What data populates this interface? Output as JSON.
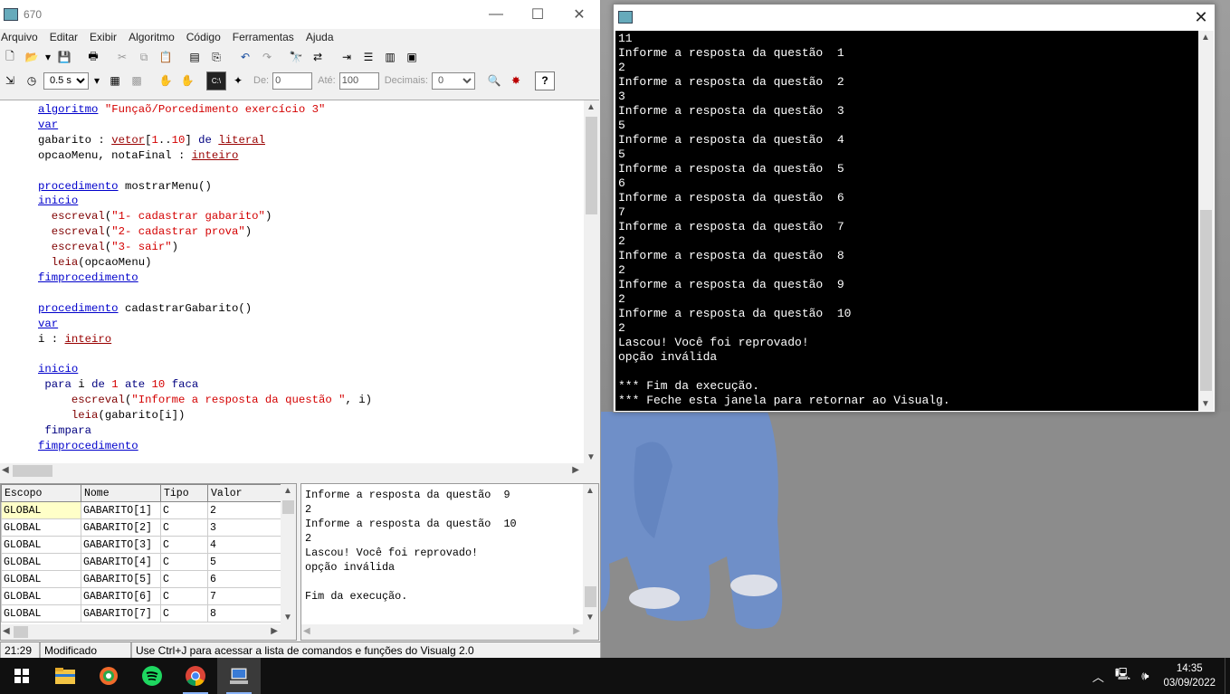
{
  "main_window": {
    "title": "670",
    "menu": [
      "Arquivo",
      "Editar",
      "Exibir",
      "Algoritmo",
      "Código",
      "Ferramentas",
      "Ajuda"
    ],
    "toolbar2": {
      "speed_value": "0.5 s",
      "de_label": "De:",
      "de_value": "0",
      "ate_label": "Até:",
      "ate_value": "100",
      "decimais_label": "Decimais:",
      "decimais_value": "0"
    },
    "code_lines": [
      "algoritmo \"Funçaõ/Porcedimento exercício 3\"",
      "var",
      "gabarito : vetor[1..10] de literal",
      "opcaoMenu, notaFinal : inteiro",
      "",
      "procedimento mostrarMenu()",
      "inicio",
      "  escreval(\"1- cadastrar gabarito\")",
      "  escreval(\"2- cadastrar prova\")",
      "  escreval(\"3- sair\")",
      "  leia(opcaoMenu)",
      "fimprocedimento",
      "",
      "procedimento cadastrarGabarito()",
      "var",
      "i : inteiro",
      "",
      "inicio",
      " para i de 1 ate 10 faca",
      "     escreval(\"Informe a resposta da questão \", i)",
      "     leia(gabarito[i])",
      " fimpara",
      "fimprocedimento"
    ],
    "variables": {
      "headers": [
        "Escopo",
        "Nome",
        "Tipo",
        "Valor"
      ],
      "rows": [
        [
          "GLOBAL",
          "GABARITO[1]",
          "C",
          "2"
        ],
        [
          "GLOBAL",
          "GABARITO[2]",
          "C",
          "3"
        ],
        [
          "GLOBAL",
          "GABARITO[3]",
          "C",
          "4"
        ],
        [
          "GLOBAL",
          "GABARITO[4]",
          "C",
          "5"
        ],
        [
          "GLOBAL",
          "GABARITO[5]",
          "C",
          "6"
        ],
        [
          "GLOBAL",
          "GABARITO[6]",
          "C",
          "7"
        ],
        [
          "GLOBAL",
          "GABARITO[7]",
          "C",
          "8"
        ]
      ]
    },
    "output_lines": [
      "Informe a resposta da questão  9",
      "2",
      "Informe a resposta da questão  10",
      "2",
      "Lascou! Você foi reprovado!",
      "opção inválida",
      "",
      "Fim da execução."
    ],
    "status": {
      "position": "21:29",
      "state": "Modificado",
      "hint": "Use Ctrl+J para acessar a lista de comandos e funções do Visualg 2.0"
    }
  },
  "console": {
    "lines": [
      "11",
      "Informe a resposta da questão  1",
      "2",
      "Informe a resposta da questão  2",
      "3",
      "Informe a resposta da questão  3",
      "5",
      "Informe a resposta da questão  4",
      "5",
      "Informe a resposta da questão  5",
      "6",
      "Informe a resposta da questão  6",
      "7",
      "Informe a resposta da questão  7",
      "2",
      "Informe a resposta da questão  8",
      "2",
      "Informe a resposta da questão  9",
      "2",
      "Informe a resposta da questão  10",
      "2",
      "Lascou! Você foi reprovado!",
      "opção inválida",
      "",
      "*** Fim da execução.",
      "*** Feche esta janela para retornar ao Visualg."
    ]
  },
  "taskbar": {
    "apps": [
      "start-icon",
      "file-explorer-icon",
      "shield-app-icon",
      "spotify-icon",
      "chrome-icon",
      "visualg-icon"
    ],
    "time": "14:35",
    "date": "03/09/2022"
  },
  "colors": {
    "keyword": "#0000cc",
    "type": "#990000",
    "string": "#d40000",
    "console_bg": "#000000",
    "taskbar_bg": "#101010"
  }
}
